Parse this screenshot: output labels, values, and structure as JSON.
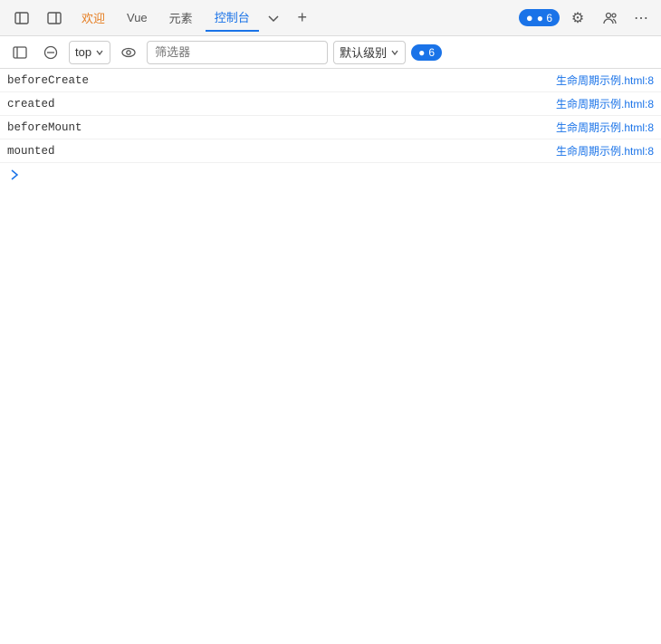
{
  "topNav": {
    "tabs": [
      {
        "id": "welcome",
        "label": "欢迎",
        "active": false
      },
      {
        "id": "vue",
        "label": "Vue",
        "active": false
      },
      {
        "id": "elements",
        "label": "元素",
        "active": false
      },
      {
        "id": "console",
        "label": "控制台",
        "active": true
      },
      {
        "id": "more",
        "label": "»",
        "active": false
      }
    ],
    "addTabLabel": "+",
    "badgeCount": "● 6",
    "badgeColor": "#1a73e8",
    "gearIcon": "⚙",
    "peopleIcon": "👥",
    "moreIcon": "⋯"
  },
  "toolbar": {
    "panelToggleIcon": "panel",
    "clearIcon": "⊘",
    "contextLabel": "top",
    "eyeIcon": "👁",
    "filterPlaceholder": "筛选器",
    "levelLabel": "默认级别",
    "badgeCount": "● 6",
    "badgeColor": "#1a73e8"
  },
  "logs": [
    {
      "message": "beforeCreate",
      "source": "生命周期示例.html:8",
      "sourceColor": "#1a73e8"
    },
    {
      "message": "created",
      "source": "生命周期示例.html:8",
      "sourceColor": "#1a73e8"
    },
    {
      "message": "beforeMount",
      "source": "生命周期示例.html:8",
      "sourceColor": "#1a73e8"
    },
    {
      "message": "mounted",
      "source": "生命周期示例.html:8",
      "sourceColor": "#1a73e8"
    }
  ],
  "expanderVisible": true
}
